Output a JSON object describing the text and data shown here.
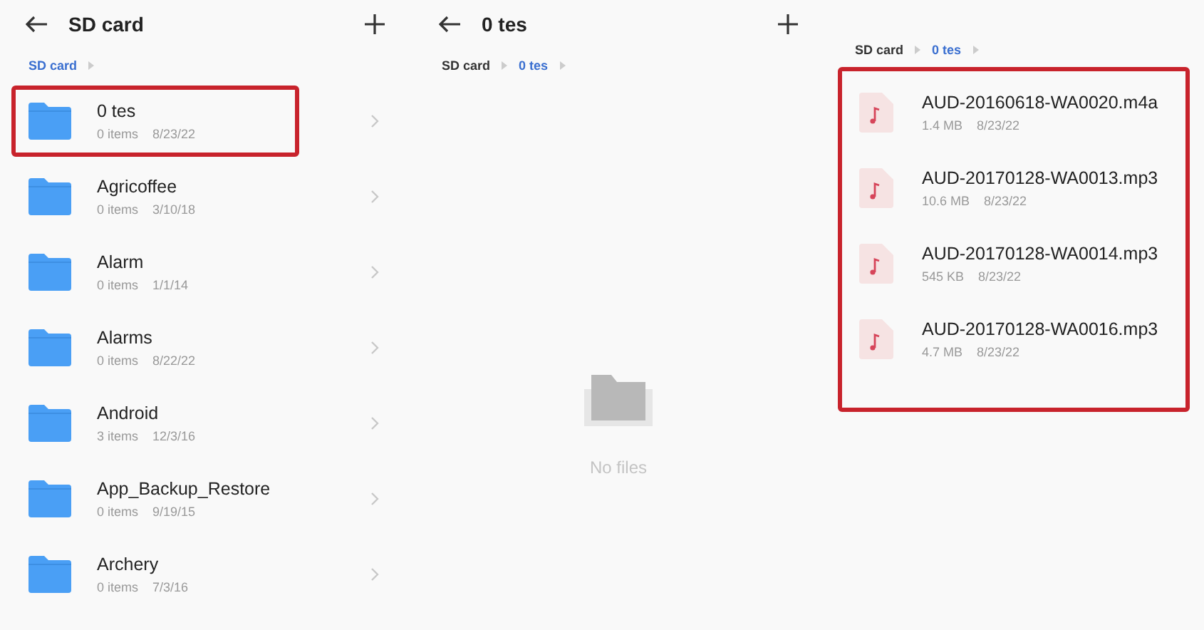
{
  "panels": [
    {
      "title": "SD card",
      "breadcrumb": [
        {
          "label": "SD card",
          "current": true
        }
      ],
      "items": [
        {
          "kind": "folder",
          "name": "0 tes",
          "size": "0 items",
          "date": "8/23/22",
          "highlighted": true
        },
        {
          "kind": "folder",
          "name": "Agricoffee",
          "size": "0 items",
          "date": "3/10/18",
          "highlighted": false
        },
        {
          "kind": "folder",
          "name": "Alarm",
          "size": "0 items",
          "date": "1/1/14",
          "highlighted": false
        },
        {
          "kind": "folder",
          "name": "Alarms",
          "size": "0 items",
          "date": "8/22/22",
          "highlighted": false
        },
        {
          "kind": "folder",
          "name": "Android",
          "size": "3 items",
          "date": "12/3/16",
          "highlighted": false
        },
        {
          "kind": "folder",
          "name": "App_Backup_Restore",
          "size": "0 items",
          "date": "9/19/15",
          "highlighted": false
        },
        {
          "kind": "folder",
          "name": "Archery",
          "size": "0 items",
          "date": "7/3/16",
          "highlighted": false
        }
      ]
    },
    {
      "title": "0 tes",
      "breadcrumb": [
        {
          "label": "SD card",
          "current": false
        },
        {
          "label": "0 tes",
          "current": true
        }
      ],
      "empty_text": "No files"
    },
    {
      "breadcrumb": [
        {
          "label": "SD card",
          "current": false
        },
        {
          "label": "0 tes",
          "current": true
        }
      ],
      "list_highlighted": true,
      "items": [
        {
          "kind": "audio",
          "name": "AUD-20160618-WA0020.m4a",
          "size": "1.4 MB",
          "date": "8/23/22",
          "highlighted": false
        },
        {
          "kind": "audio",
          "name": "AUD-20170128-WA0013.mp3",
          "size": "10.6 MB",
          "date": "8/23/22",
          "highlighted": false
        },
        {
          "kind": "audio",
          "name": "AUD-20170128-WA0014.mp3",
          "size": "545 KB",
          "date": "8/23/22",
          "highlighted": false
        },
        {
          "kind": "audio",
          "name": "AUD-20170128-WA0016.mp3",
          "size": "4.7 MB",
          "date": "8/23/22",
          "highlighted": false
        }
      ]
    }
  ]
}
